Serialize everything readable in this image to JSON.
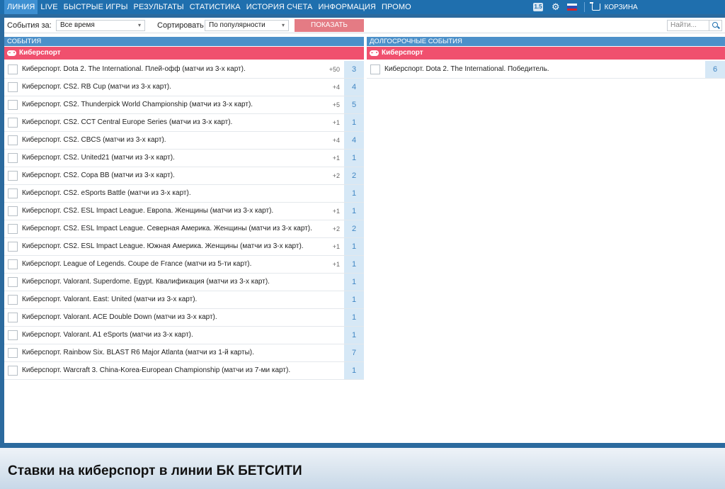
{
  "nav": {
    "items": [
      "ЛИНИЯ",
      "LIVE",
      "БЫСТРЫЕ ИГРЫ",
      "РЕЗУЛЬТАТЫ",
      "СТАТИСТИКА",
      "ИСТОРИЯ СЧЕТА",
      "ИНФОРМАЦИЯ",
      "ПРОМО"
    ],
    "active": "ЛИНИЯ",
    "odds_badge": "1.5",
    "cart_label": "КОРЗИНА"
  },
  "filters": {
    "events_for_label": "События за:",
    "events_for_value": "Все время",
    "sort_label": "Сортировать",
    "sort_value": "По популярности",
    "show_button": "ПОКАЗАТЬ",
    "search_placeholder": "Найти..."
  },
  "events": {
    "header": "СОБЫТИЯ",
    "sport": "Киберспорт",
    "rows": [
      {
        "label": "Киберспорт. Dota 2. The International. Плей-офф (матчи из 3-х карт).",
        "plus": "+50",
        "count": "3"
      },
      {
        "label": "Киберспорт. CS2. RB Cup (матчи из 3-х карт).",
        "plus": "+4",
        "count": "4"
      },
      {
        "label": "Киберспорт. CS2. Thunderpick World Championship (матчи из 3-х карт).",
        "plus": "+5",
        "count": "5"
      },
      {
        "label": "Киберспорт. CS2. CCT Central Europe Series (матчи из 3-х карт).",
        "plus": "+1",
        "count": "1"
      },
      {
        "label": "Киберспорт. CS2. CBCS (матчи из 3-х карт).",
        "plus": "+4",
        "count": "4"
      },
      {
        "label": "Киберспорт. CS2. United21 (матчи из 3-х карт).",
        "plus": "+1",
        "count": "1"
      },
      {
        "label": "Киберспорт. CS2. Copa BB (матчи из 3-х карт).",
        "plus": "+2",
        "count": "2"
      },
      {
        "label": "Киберспорт. CS2. eSports Battle (матчи из 3-х карт).",
        "plus": "",
        "count": "1"
      },
      {
        "label": "Киберспорт. CS2. ESL Impact League. Европа. Женщины (матчи из 3-х карт).",
        "plus": "+1",
        "count": "1"
      },
      {
        "label": "Киберспорт. CS2. ESL Impact League. Северная Америка. Женщины (матчи из 3-х карт).",
        "plus": "+2",
        "count": "2"
      },
      {
        "label": "Киберспорт. CS2. ESL Impact League. Южная Америка. Женщины (матчи из 3-х карт).",
        "plus": "+1",
        "count": "1"
      },
      {
        "label": "Киберспорт. League of Legends. Coupe de France (матчи из 5-ти карт).",
        "plus": "+1",
        "count": "1"
      },
      {
        "label": "Киберспорт. Valorant. Superdome. Egypt. Квалификация (матчи из 3-х карт).",
        "plus": "",
        "count": "1"
      },
      {
        "label": "Киберспорт. Valorant. East: United (матчи из 3-х карт).",
        "plus": "",
        "count": "1"
      },
      {
        "label": "Киберспорт. Valorant. ACE Double Down (матчи из 3-х карт).",
        "plus": "",
        "count": "1"
      },
      {
        "label": "Киберспорт. Valorant. A1 eSports (матчи из 3-х карт).",
        "plus": "",
        "count": "1"
      },
      {
        "label": "Киберспорт. Rainbow Six. BLAST R6 Major Atlanta (матчи из 1-й карты).",
        "plus": "",
        "count": "7"
      },
      {
        "label": "Киберспорт. Warcraft 3. China-Korea-European Championship (матчи из 7-ми карт).",
        "plus": "",
        "count": "1"
      }
    ]
  },
  "longterm": {
    "header": "ДОЛГОСРОЧНЫЕ СОБЫТИЯ",
    "sport": "Киберспорт",
    "rows": [
      {
        "label": "Киберспорт. Dota 2. The International. Победитель.",
        "plus": "",
        "count": "6"
      }
    ]
  },
  "bottom_title": "Ставки на киберспорт в линии БК БЕТСИТИ",
  "colors": {
    "nav_bg": "#1f6fae",
    "accent_red": "#f0506e",
    "section_blue": "#4c90c9",
    "count_bg": "#d6e8f6"
  }
}
